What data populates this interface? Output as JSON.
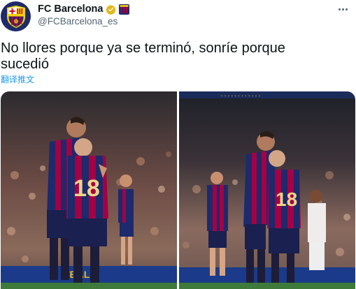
{
  "tweet": {
    "display_name": "FC Barcelona",
    "handle": "@FCBarcelona_es",
    "text": "No llores porque ya se terminó, sonríe porque sucedió",
    "translate_label": "翻译推文"
  },
  "icons": {
    "verified": "verified-badge-icon",
    "affiliation": "affiliation-badge-icon",
    "more": "more-options-icon"
  },
  "colors": {
    "link": "#1d9bf0",
    "secondary_text": "#536471",
    "verified_gold": "#e2b719",
    "barca_blue": "#1d2a6b",
    "barca_red": "#a50044"
  },
  "media": {
    "photos": [
      {
        "jersey_number": "18"
      },
      {
        "jersey_number": "18"
      }
    ]
  }
}
